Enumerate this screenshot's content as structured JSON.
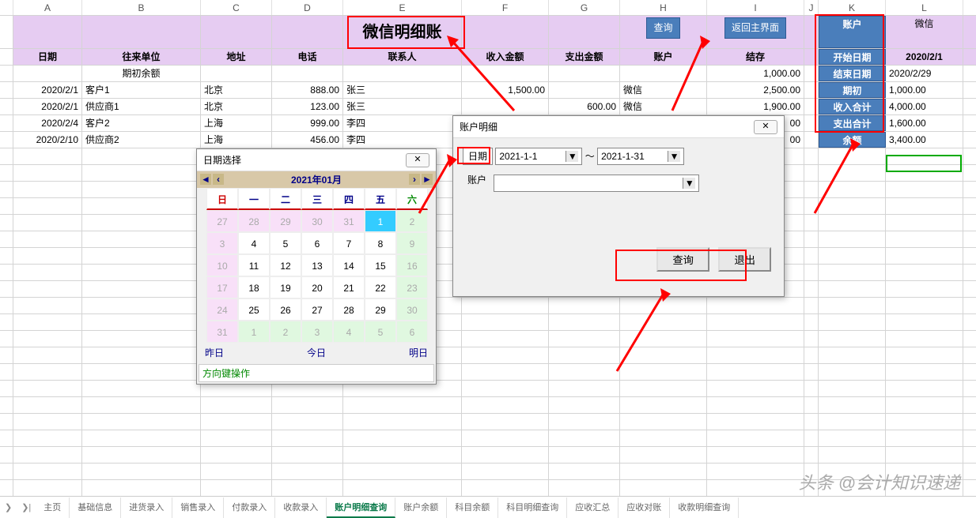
{
  "cols": [
    "",
    "A",
    "B",
    "C",
    "D",
    "E",
    "F",
    "G",
    "H",
    "I",
    "J",
    "K",
    "L"
  ],
  "title": "微信明细账",
  "btn_query": "查询",
  "btn_return": "返回主界面",
  "headers": {
    "date": "日期",
    "partner": "往来单位",
    "addr": "地址",
    "phone": "电话",
    "contact": "联系人",
    "income": "收入金额",
    "expense": "支出金额",
    "account": "账户",
    "balance": "结存"
  },
  "opening_label": "期初余额",
  "opening_val": "1,000.00",
  "rows": [
    {
      "d": "2020/2/1",
      "p": "客户1",
      "a": "北京",
      "ph": "888.00",
      "c": "张三",
      "in": "1,500.00",
      "ex": "",
      "ac": "微信",
      "bal": "2,500.00"
    },
    {
      "d": "2020/2/1",
      "p": "供应商1",
      "a": "北京",
      "ph": "123.00",
      "c": "张三",
      "in": "",
      "ex": "600.00",
      "ac": "微信",
      "bal": "1,900.00"
    },
    {
      "d": "2020/2/4",
      "p": "客户2",
      "a": "上海",
      "ph": "999.00",
      "c": "李四",
      "in": "",
      "ex": "",
      "ac": "",
      "bal": "00"
    },
    {
      "d": "2020/2/10",
      "p": "供应商2",
      "a": "上海",
      "ph": "456.00",
      "c": "李四",
      "in": "",
      "ex": "",
      "ac": "",
      "bal": "00"
    }
  ],
  "summary": {
    "account_l": "账户",
    "account_v": "微信",
    "start_l": "开始日期",
    "start_v": "2020/2/1",
    "end_l": "结束日期",
    "end_v": "2020/2/29",
    "open_l": "期初",
    "open_v": "1,000.00",
    "inc_l": "收入合计",
    "inc_v": "4,000.00",
    "exp_l": "支出合计",
    "exp_v": "1,600.00",
    "rem_l": "余额",
    "rem_v": "3,400.00"
  },
  "dlg_date": {
    "title": "日期选择",
    "month": "2021年01月",
    "wh": [
      "日",
      "一",
      "二",
      "三",
      "四",
      "五",
      "六"
    ],
    "grid": [
      [
        "27",
        "p"
      ],
      [
        "28",
        "p"
      ],
      [
        "29",
        "p"
      ],
      [
        "30",
        "p"
      ],
      [
        "31",
        "p"
      ],
      [
        "1",
        "t"
      ],
      [
        "2",
        "n"
      ],
      [
        "3",
        "p"
      ],
      [
        "4",
        ""
      ],
      [
        "5",
        ""
      ],
      [
        "6",
        ""
      ],
      [
        "7",
        ""
      ],
      [
        "8",
        ""
      ],
      [
        "9",
        "n"
      ],
      [
        "10",
        "p"
      ],
      [
        "11",
        ""
      ],
      [
        "12",
        ""
      ],
      [
        "13",
        ""
      ],
      [
        "14",
        ""
      ],
      [
        "15",
        ""
      ],
      [
        "16",
        "n"
      ],
      [
        "17",
        "p"
      ],
      [
        "18",
        ""
      ],
      [
        "19",
        ""
      ],
      [
        "20",
        ""
      ],
      [
        "21",
        ""
      ],
      [
        "22",
        ""
      ],
      [
        "23",
        "n"
      ],
      [
        "24",
        "p"
      ],
      [
        "25",
        ""
      ],
      [
        "26",
        ""
      ],
      [
        "27",
        ""
      ],
      [
        "28",
        ""
      ],
      [
        "29",
        ""
      ],
      [
        "30",
        "n"
      ],
      [
        "31",
        "p"
      ],
      [
        "1",
        "n"
      ],
      [
        "2",
        "n"
      ],
      [
        "3",
        "n"
      ],
      [
        "4",
        "n"
      ],
      [
        "5",
        "n"
      ],
      [
        "6",
        "n"
      ]
    ],
    "yest": "昨日",
    "today": "今日",
    "tom": "明日",
    "hint": "方向键操作"
  },
  "dlg_acc": {
    "title": "账户明细",
    "date_l": "日期",
    "d1": "2021-1-1",
    "sep": "～",
    "d2": "2021-1-31",
    "acc_l": "账户",
    "q": "查询",
    "x": "退出"
  },
  "tabs": [
    "主页",
    "基础信息",
    "进货录入",
    "销售录入",
    "付款录入",
    "收款录入",
    "账户明细查询",
    "账户余额",
    "科目余额",
    "科目明细查询",
    "应收汇总",
    "应收对账",
    "收款明细查询"
  ],
  "active_tab": 6,
  "watermark": "头条 @会计知识速递"
}
